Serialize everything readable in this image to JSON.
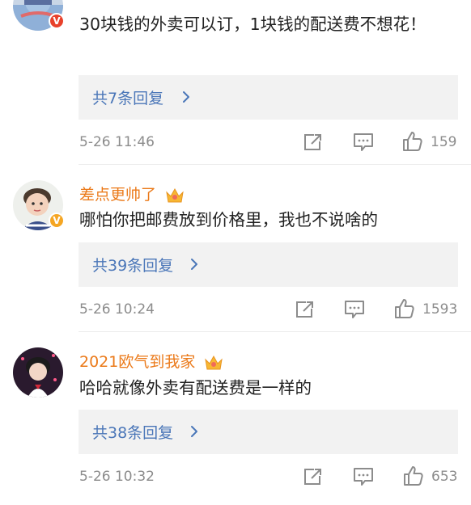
{
  "comments": [
    {
      "username": "",
      "badge": "V",
      "text": "30块钱的外卖可以订，1块钱的配送费不想花！",
      "replies_label": "共7条回复",
      "time": "5-26 11:46",
      "likes": "159"
    },
    {
      "username": "差点更帅了",
      "badge": "V",
      "text": "哪怕你把邮费放到价格里，我也不说啥的",
      "replies_label": "共39条回复",
      "time": "5-26 10:24",
      "likes": "1593"
    },
    {
      "username": "2021欧气到我家",
      "text": "哈哈就像外卖有配送费是一样的",
      "replies_label": "共38条回复",
      "time": "5-26 10:32",
      "likes": "653"
    }
  ],
  "colors": {
    "username": "#eb7a1a",
    "link": "#4a76b8",
    "meta": "#8c8c8c",
    "verified_gold": "#f5a623",
    "verified_red": "#e8412b"
  },
  "icons": [
    "share-icon",
    "comment-icon",
    "like-icon",
    "chevron-right-icon",
    "crown-icon"
  ]
}
